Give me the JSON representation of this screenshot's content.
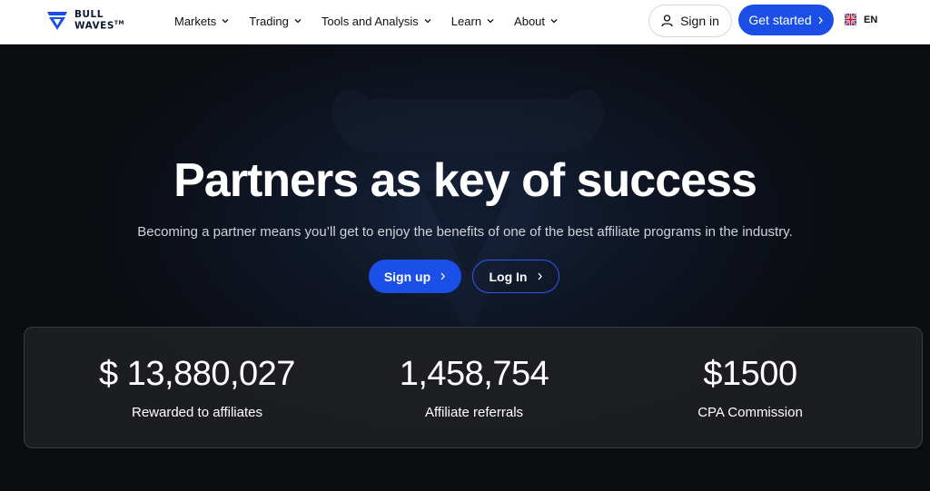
{
  "header": {
    "logo_line1": "BULL",
    "logo_line2": "WAVES",
    "logo_tm": "TM",
    "nav": [
      {
        "label": "Markets"
      },
      {
        "label": "Trading"
      },
      {
        "label": "Tools and Analysis"
      },
      {
        "label": "Learn"
      },
      {
        "label": "About"
      }
    ],
    "signin_label": "Sign in",
    "get_started_label": "Get started",
    "language": "EN"
  },
  "hero": {
    "title": "Partners as key of success",
    "subtitle": "Becoming a partner means you’ll get to enjoy the benefits of one of the best affiliate programs in the industry.",
    "signup_label": "Sign up",
    "login_label": "Log In"
  },
  "stats": [
    {
      "value": "$ 13,880,027",
      "label": "Rewarded to affiliates"
    },
    {
      "value": "1,458,754",
      "label": "Affiliate referrals"
    },
    {
      "value": "$1500",
      "label": "CPA Commission"
    }
  ],
  "colors": {
    "accent": "#1b4ee6",
    "background": "#0b0c10",
    "stats_panel": "#1e1f23"
  }
}
